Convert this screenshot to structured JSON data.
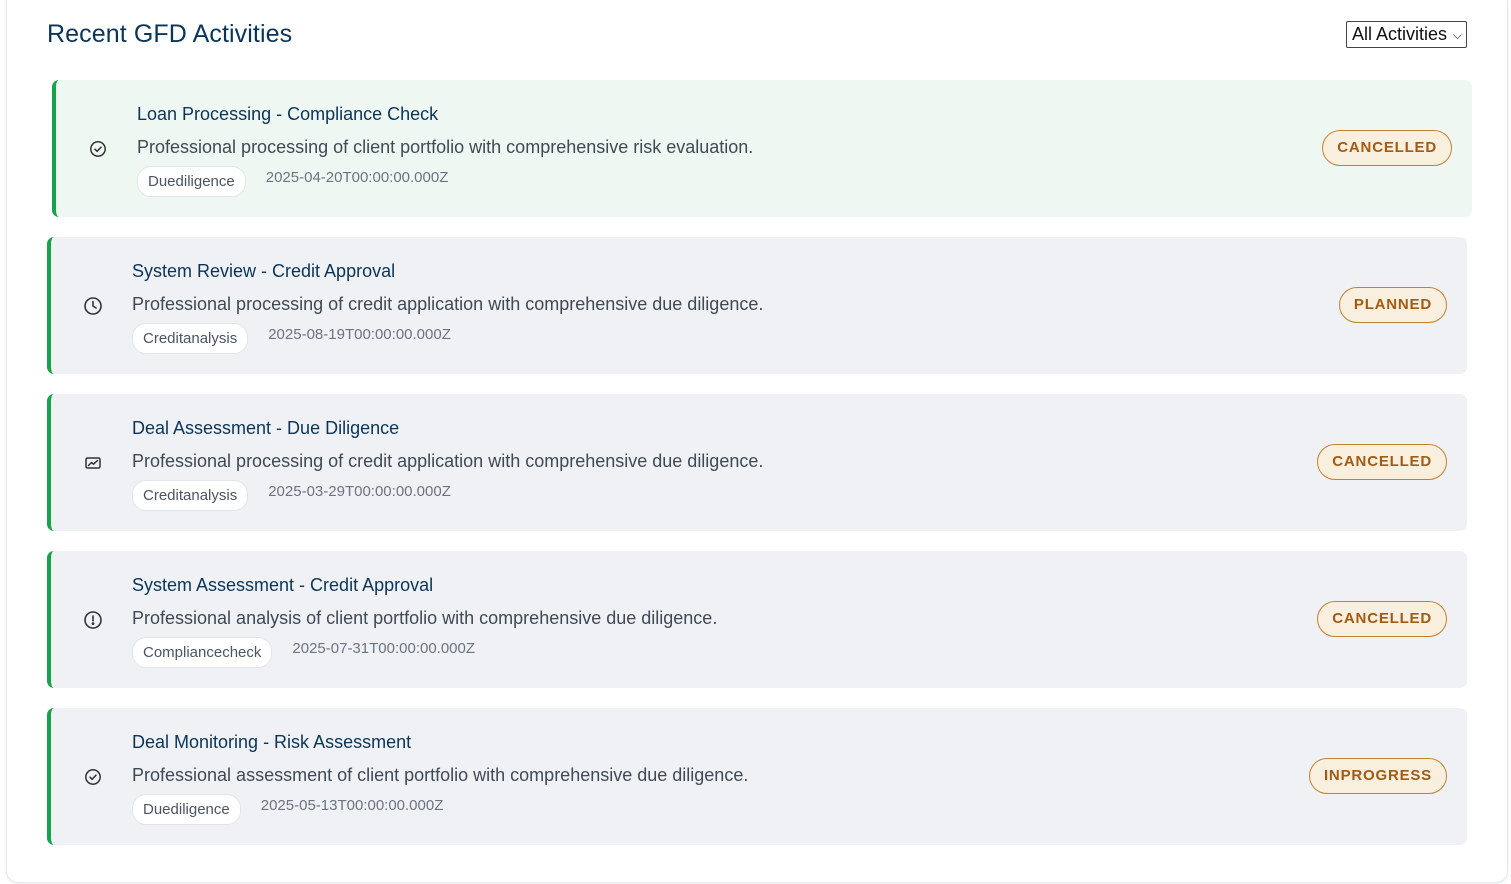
{
  "header": {
    "title": "Recent GFD Activities",
    "filter_value": "All Activities"
  },
  "activities": [
    {
      "title": "Loan Processing - Compliance Check",
      "description": "Professional processing of client portfolio with comprehensive risk evaluation.",
      "tag": "Duediligence",
      "timestamp": "2025-04-20T00:00:00.000Z",
      "status": "CANCELLED",
      "icon": "check-circle-icon"
    },
    {
      "title": "System Review - Credit Approval",
      "description": "Professional processing of credit application with comprehensive due diligence.",
      "tag": "Creditanalysis",
      "timestamp": "2025-08-19T00:00:00.000Z",
      "status": "PLANNED",
      "icon": "clock-icon"
    },
    {
      "title": "Deal Assessment - Due Diligence",
      "description": "Professional processing of credit application with comprehensive due diligence.",
      "tag": "Creditanalysis",
      "timestamp": "2025-03-29T00:00:00.000Z",
      "status": "CANCELLED",
      "icon": "chart-icon"
    },
    {
      "title": "System Assessment - Credit Approval",
      "description": "Professional analysis of client portfolio with comprehensive due diligence.",
      "tag": "Compliancecheck",
      "timestamp": "2025-07-31T00:00:00.000Z",
      "status": "CANCELLED",
      "icon": "alert-circle-icon"
    },
    {
      "title": "Deal Monitoring - Risk Assessment",
      "description": "Professional assessment of client portfolio with comprehensive due diligence.",
      "tag": "Duediligence",
      "timestamp": "2025-05-13T00:00:00.000Z",
      "status": "INPROGRESS",
      "icon": "check-circle-icon"
    }
  ],
  "colors": {
    "accent_border": "#16a34a",
    "title_text": "#0b3558",
    "status_text": "#a35a12",
    "status_bg": "#f9efdf"
  }
}
